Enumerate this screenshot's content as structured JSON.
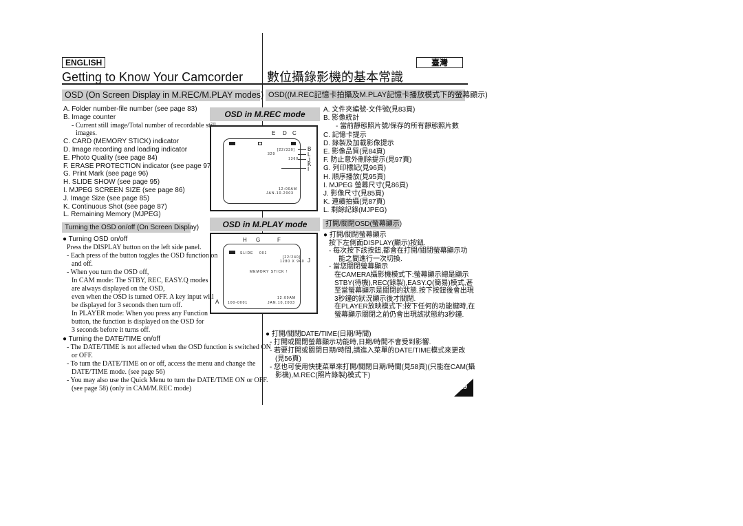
{
  "header": {
    "lang_en": "ENGLISH",
    "lang_tw": "臺灣",
    "title_en": "Getting to Know Your Camcorder",
    "title_tw": "數位攝錄影機的基本常識"
  },
  "section": {
    "en": "OSD (On Screen Display in M.REC/M.PLAY modes)",
    "tw": "OSD((M.REC記憶卡拍攝及M.PLAY記憶卡播放模式下的螢幕顯示)"
  },
  "list_en": [
    "A. Folder number-file number (see page 83)",
    "B. Image counter",
    "- Current still image/Total number of recordable still",
    "images.",
    "C. CARD (MEMORY STICK) indicator",
    "D. Image recording and loading indicator",
    "E. Photo Quality (see page 84)",
    "F. ERASE PROTECTION indicator (see page 97)",
    "G. Print Mark (see page 96)",
    "H. SLIDE SHOW (see page 95)",
    "I. MJPEG SCREEN SIZE (see page 86)",
    "J. Image Size (see page 85)",
    "K. Continuous Shot (see page 87)",
    "L. Remaining Memory (MJPEG)"
  ],
  "list_tw": [
    "A. 文件夾編號-文件號(見83頁)",
    "B. 影像統計",
    "- 當前靜態照片號/保存的所有靜態照片數",
    "C. 記憶卡提示",
    "D. 錄製及加載影像提示",
    "E. 影像品質(見84頁)",
    "F. 防止意外刪除提示(見97頁)",
    "G. 列印標記(見96頁)",
    "H. 順序播放(見95頁)",
    "I. MJPEG 螢幕尺寸(見86頁)",
    "J. 影像尺寸(見85頁)",
    "K. 連續拍攝(見87頁)",
    "L. 剩餘記錄(MJPEG)"
  ],
  "osd_en": {
    "heading": "Turning the OSD on/off (On Screen Display)",
    "lines": [
      "● Turning OSD on/off",
      "Press the DISPLAY button on the left side panel.",
      "- Each press of the button toggles the OSD function on",
      "and off.",
      "- When you turn the OSD off,",
      "In CAM mode: The STBY, REC, EASY.Q modes",
      "are always displayed on the OSD,",
      "even when the OSD is turned OFF. A key input will",
      "be displayed for 3 seconds then turn off.",
      "In PLAYER mode: When you press any Function",
      "button, the function is displayed on the OSD for",
      "3 seconds before it turns off."
    ]
  },
  "datetime_en": [
    "● Turning the DATE/TIME on/off",
    "- The DATE/TIME is not affected when the OSD function is switched ON",
    "or OFF.",
    "- To turn the DATE/TIME on or off, access the menu and change the",
    "DATE/TIME mode. (see page 56)",
    "- You may also use the Quick Menu to turn the DATE/TIME ON or OFF.",
    "(see page 58) (only in CAM/M.REC mode)"
  ],
  "osd_tw": {
    "heading": "打開/關閉OSD(螢幕顯示)",
    "lines": [
      "● 打開/關閉螢幕顯示",
      "按下左側面DISPLAY(顯示)按鈕.",
      "- 每次按下該按鈕,都會在打開/關閉螢幕顯示功",
      "能之間進行一次切換.",
      "- 當您關閉螢幕顯示",
      "在CAMERA攝影機模式下:螢幕顯示總是顯示",
      "STBY(待機),REC(錄製),EASY.Q(簡易)模式,甚",
      "至當螢幕顯示是關閉的狀態.按下按鈕後會出現",
      "3秒鐘的狀況顯示後才關閉.",
      "在PLAYER放映模式下:按下任何的功能鍵時,在",
      "螢幕顯示關閉之前仍會出現該狀態約3秒鐘."
    ]
  },
  "datetime_tw": [
    "● 打開/關閉DATE/TIME(日期/時間)",
    "- 打開或關閉螢幕顯示功能時,日期/時間不會受到影響.",
    "- 若要打開或關閉日期/時間,請進入菜單的DATE/TIME模式來更改",
    "(見56頁)",
    "- 您也可使用快捷菜單來打開/關閉日期/時間(見58頁)(只能在CAM(攝",
    "影機),M.REC(照片錄製)模式下)"
  ],
  "mrec": {
    "title": "OSD in M.REC mode",
    "labels": [
      "E",
      "D",
      "C",
      "B",
      "L",
      "J",
      "K",
      "I"
    ],
    "counter": "[22/330]",
    "remain": "329",
    "size": "1360",
    "time": "12:00AM",
    "date": "JAN.10.2003"
  },
  "mplay": {
    "title": "OSD in M.PLAY mode",
    "labels": [
      "H",
      "G",
      "F",
      "J",
      "A"
    ],
    "slide": "SLIDE",
    "print": "001",
    "counter": "[22/240]",
    "size": "1280 X 960",
    "memory": "MEMORY STICK !",
    "time": "12:00AM",
    "date": "JAN.10,2003",
    "file": "100-0001"
  },
  "page_number": "19"
}
